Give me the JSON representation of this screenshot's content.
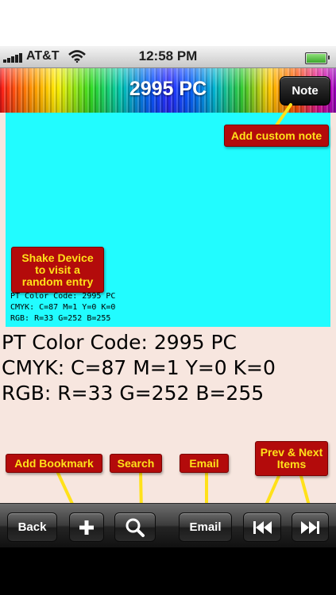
{
  "status_bar": {
    "carrier": "AT&T",
    "time": "12:58 PM"
  },
  "nav_bar": {
    "title": "2995 PC",
    "note_button": "Note"
  },
  "swatch": {
    "color": "#21fcff",
    "info_lines": [
      "PT Color Code: 2995 PC",
      "CMYK: C=87 M=1 Y=0 K=0",
      "RGB: R=33 G=252 B=255"
    ]
  },
  "details": {
    "code_line": "PT Color Code: 2995 PC",
    "cmyk_line": "CMYK: C=87 M=1 Y=0 K=0",
    "rgb_line": "RGB: R=33 G=252 B=255"
  },
  "callouts": {
    "custom_note": "Add custom note",
    "shake": "Shake Device to visit a random entry",
    "bookmark": "Add Bookmark",
    "search": "Search",
    "email": "Email",
    "prev_next": "Prev & Next Items"
  },
  "toolbar": {
    "back": "Back",
    "email": "Email"
  },
  "icons": {
    "add": "plus-icon",
    "search": "magnifier-icon",
    "prev": "rewind-icon",
    "next": "fast-forward-icon",
    "wifi": "wifi-icon",
    "battery": "battery-icon"
  },
  "colors": {
    "callout_bg": "#b30b0b",
    "callout_text": "#ffe11a",
    "leader_line": "#ffe11a",
    "content_bg": "#f7e6df"
  }
}
